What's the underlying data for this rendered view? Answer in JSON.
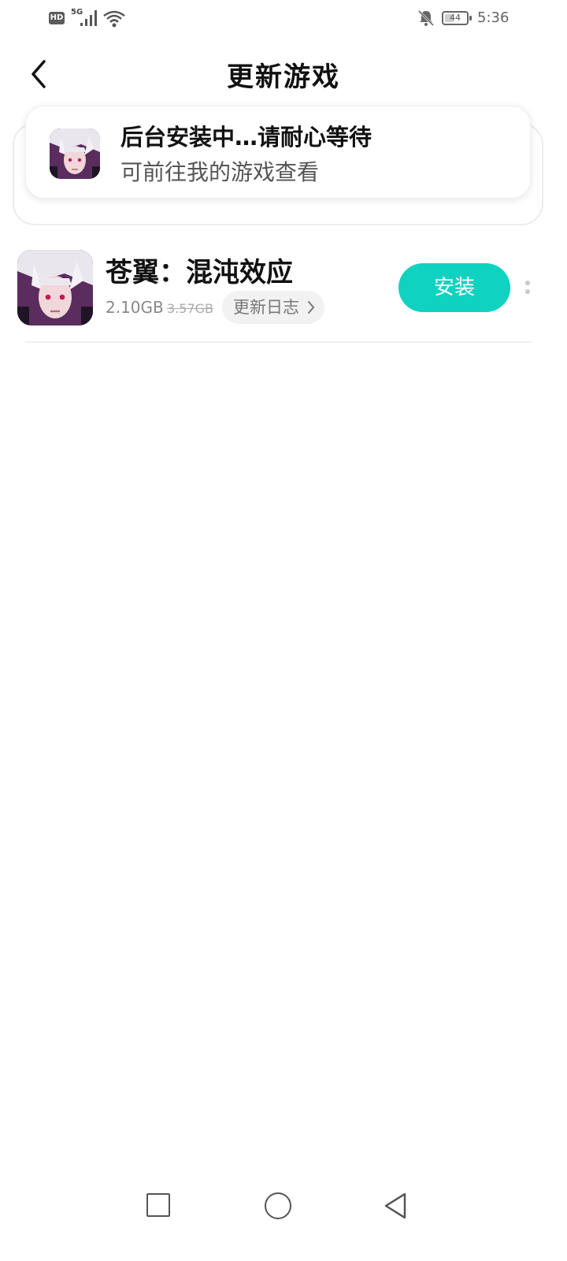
{
  "status_bar": {
    "hd": "HD",
    "network": "5G",
    "battery": "44",
    "battery_level": 0.44,
    "time": "5:36",
    "icons": [
      "signal-icon",
      "wifi-icon",
      "mute-icon",
      "battery-icon"
    ]
  },
  "header": {
    "title": "更新游戏",
    "back_icon": "chevron-left-icon"
  },
  "toast": {
    "title": "后台安装中…请耐心等待",
    "subtitle": "可前往我的游戏查看"
  },
  "game": {
    "name": "苍翼：混沌效应",
    "size_current": "2.10GB",
    "size_original": "3.57GB",
    "changelog_label": "更新日志",
    "install_label": "安装",
    "accent_color": "#0fd3c0"
  },
  "nav_bar": {
    "icons": [
      "recent-apps-icon",
      "home-icon",
      "back-icon"
    ]
  }
}
